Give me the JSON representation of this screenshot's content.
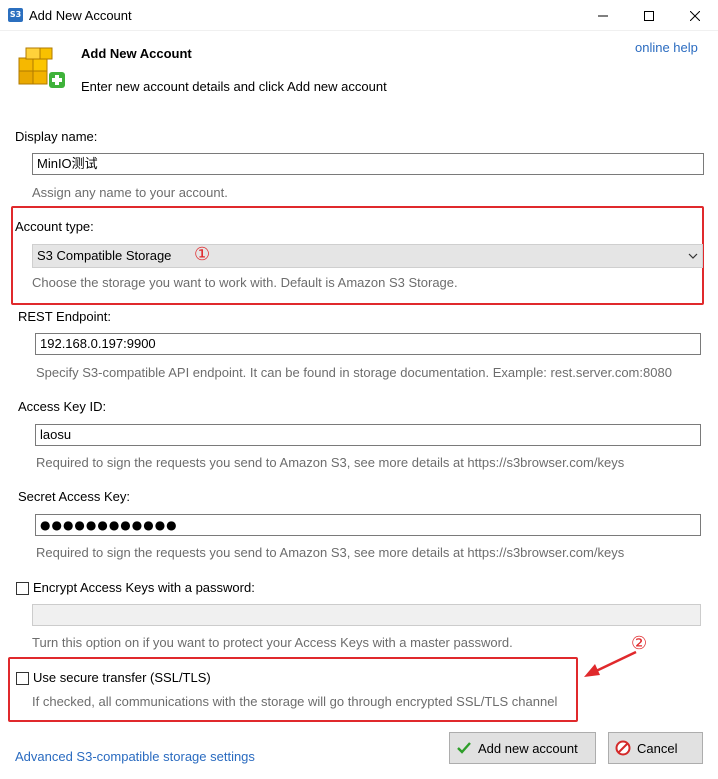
{
  "window": {
    "app_icon_text": "S3",
    "title": "Add New Account",
    "minimize_glyph": "—",
    "maximize_glyph": "☐",
    "close_glyph": "✕"
  },
  "header": {
    "icon": "cubes-add-icon",
    "title": "Add New Account",
    "subtitle": "Enter new account details and click Add new account",
    "help_link": "online help"
  },
  "form": {
    "display_name": {
      "label": "Display name:",
      "value": "MinIO测试",
      "hint": "Assign any name to your account."
    },
    "account_type": {
      "label": "Account type:",
      "selected": "S3 Compatible Storage",
      "hint": "Choose the storage you want to work with. Default is Amazon S3 Storage."
    },
    "rest_endpoint": {
      "label": "REST Endpoint:",
      "value": "192.168.0.197:9900",
      "hint": "Specify S3-compatible API endpoint. It can be found in storage documentation. Example: rest.server.com:8080"
    },
    "access_key": {
      "label": "Access Key ID:",
      "value": "laosu",
      "hint": "Required to sign the requests you send to Amazon S3, see more details at https://s3browser.com/keys"
    },
    "secret_key": {
      "label": "Secret Access Key:",
      "value": "●●●●●●●●●●●●",
      "hint": "Required to sign the requests you send to Amazon S3, see more details at https://s3browser.com/keys"
    },
    "encrypt": {
      "label": "Encrypt Access Keys with a password:",
      "checked": false,
      "hint": "Turn this option on if you want to protect your Access Keys with a master password."
    },
    "ssl": {
      "label": "Use secure transfer (SSL/TLS)",
      "checked": false,
      "hint": "If checked, all communications with the storage will go through encrypted SSL/TLS channel"
    }
  },
  "annotations": {
    "num1": "①",
    "num2": "②",
    "color": "#e0292c"
  },
  "footer": {
    "advanced_link": "Advanced S3-compatible storage settings",
    "add_button": "Add new account",
    "cancel_button": "Cancel"
  },
  "colors": {
    "link": "#2a6bc0",
    "hint": "#6d6d6d"
  }
}
